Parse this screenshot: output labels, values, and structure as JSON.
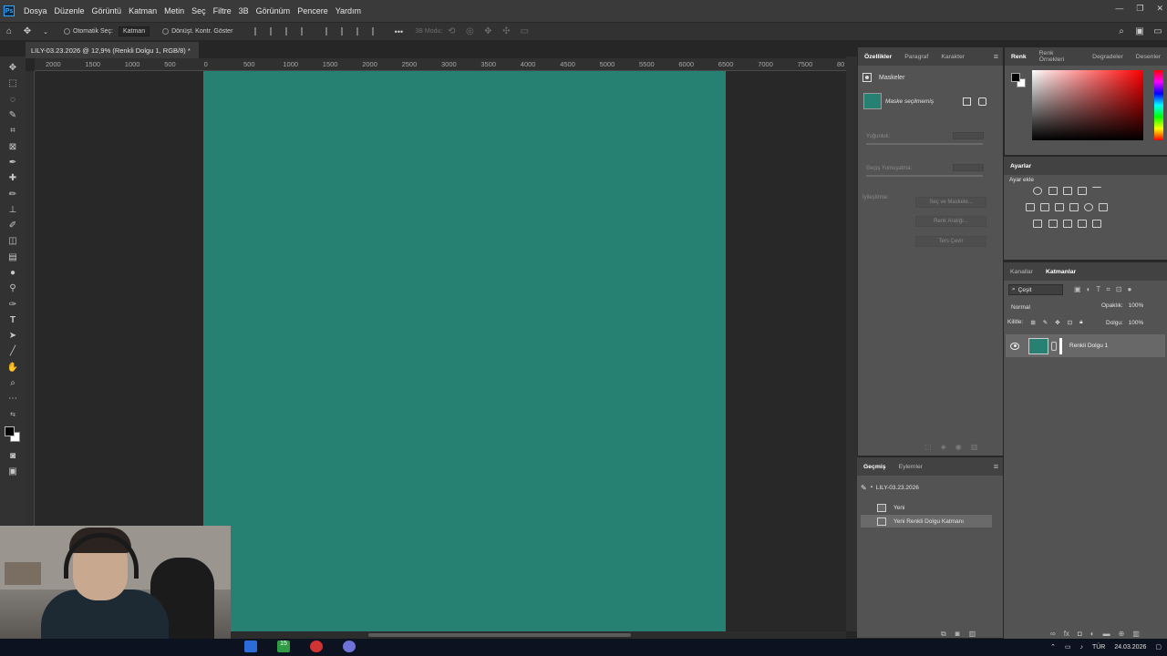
{
  "menubar": {
    "logo": "Ps",
    "items": [
      "Dosya",
      "Düzenle",
      "Görüntü",
      "Katman",
      "Metin",
      "Seç",
      "Filtre",
      "3B",
      "Görünüm",
      "Pencere",
      "Yardım"
    ],
    "window_controls": [
      "—",
      "❐",
      "✕"
    ]
  },
  "options_bar": {
    "auto_select_label": "Otomatik Seç:",
    "auto_select_target": "Katman",
    "show_transform_label": "Dönüşt. Kontr. Göster",
    "mode_3d_label": "3B Modu:",
    "more_label": "•••"
  },
  "document": {
    "tab_title": "LILY-03.23.2026 @ 12,9% (Renkli Dolgu 1, RGB/8) *",
    "fill_color": "#268172"
  },
  "ruler": {
    "ticks": [
      "2000",
      "1500",
      "1000",
      "500",
      "0",
      "500",
      "1000",
      "1500",
      "2000",
      "2500",
      "3000",
      "3500",
      "4000",
      "4500",
      "5000",
      "5500",
      "6000",
      "6500",
      "7000",
      "7500",
      "80"
    ]
  },
  "properties_panel": {
    "tabs": [
      "Özellikler",
      "Paragraf",
      "Karakter"
    ],
    "masks_label": "Maskeler",
    "mask_status": "Maske seçilmemiş",
    "density_label": "Yoğunluk:",
    "feather_label": "Geçiş Yumuşatma:",
    "refine_label": "İyileştirme:",
    "select_and_mask": "Seç ve Maskele...",
    "color_range": "Renk Aralığı...",
    "invert": "Ters Çevir"
  },
  "history_panel": {
    "tabs": [
      "Geçmiş",
      "Eylemler"
    ],
    "snapshot": "LILY-03.23.2026",
    "items": [
      "Yeni",
      "Yeni Renkli Dolgu Katmanı"
    ]
  },
  "color_panel": {
    "tabs": [
      "Renk",
      "Renk Örnekleri",
      "Degradeler",
      "Desenler"
    ]
  },
  "adjustments_panel": {
    "title": "Ayarlar",
    "add_label": "Ayar ekle"
  },
  "layers_panel": {
    "tabs": [
      "Kanallar",
      "Katmanlar"
    ],
    "kind_filter": "Çeşit",
    "blend_mode": "Normal",
    "opacity_label": "Opaklık:",
    "opacity_value": "100%",
    "lock_label": "Kilitle:",
    "fill_label": "Dolgu:",
    "fill_value": "100%",
    "layer_name": "Renkli Dolgu 1"
  },
  "taskbar": {
    "badge": "15",
    "language": "TÜR",
    "date": "24.03.2026"
  }
}
